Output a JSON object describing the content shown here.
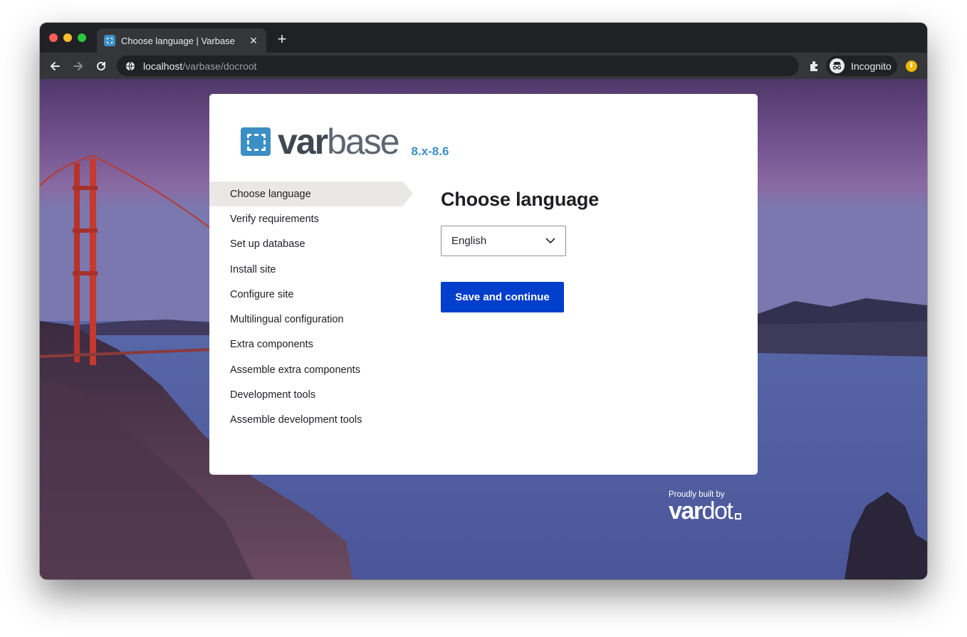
{
  "browser": {
    "tab_title": "Choose language | Varbase",
    "tab_close_glyph": "×",
    "new_tab_glyph": "+",
    "url_host": "localhost",
    "url_path": "/varbase/docroot",
    "incognito_label": "Incognito",
    "icons": {
      "back": "arrow-left-icon",
      "forward": "arrow-right-icon",
      "reload": "reload-icon",
      "site_info": "globe-icon",
      "extensions": "puzzle-icon",
      "incognito": "incognito-icon",
      "update": "update-icon"
    }
  },
  "installer": {
    "logo": {
      "word_bold": "var",
      "word_light": "base",
      "version": "8.x-8.6"
    },
    "steps": [
      {
        "label": "Choose language",
        "active": true
      },
      {
        "label": "Verify requirements",
        "active": false
      },
      {
        "label": "Set up database",
        "active": false
      },
      {
        "label": "Install site",
        "active": false
      },
      {
        "label": "Configure site",
        "active": false
      },
      {
        "label": "Multilingual configuration",
        "active": false
      },
      {
        "label": "Extra components",
        "active": false
      },
      {
        "label": "Assemble extra components",
        "active": false
      },
      {
        "label": "Development tools",
        "active": false
      },
      {
        "label": "Assemble development tools",
        "active": false
      }
    ],
    "heading": "Choose language",
    "language_select": {
      "value": "English"
    },
    "submit_label": "Save and continue"
  },
  "credit": {
    "prefix": "Proudly built by",
    "brand_bold": "var",
    "brand_light": "dot"
  },
  "colors": {
    "accent": "#3b8fc4",
    "primary_button": "#003ecc",
    "active_step_bg": "#e9e8e4"
  }
}
